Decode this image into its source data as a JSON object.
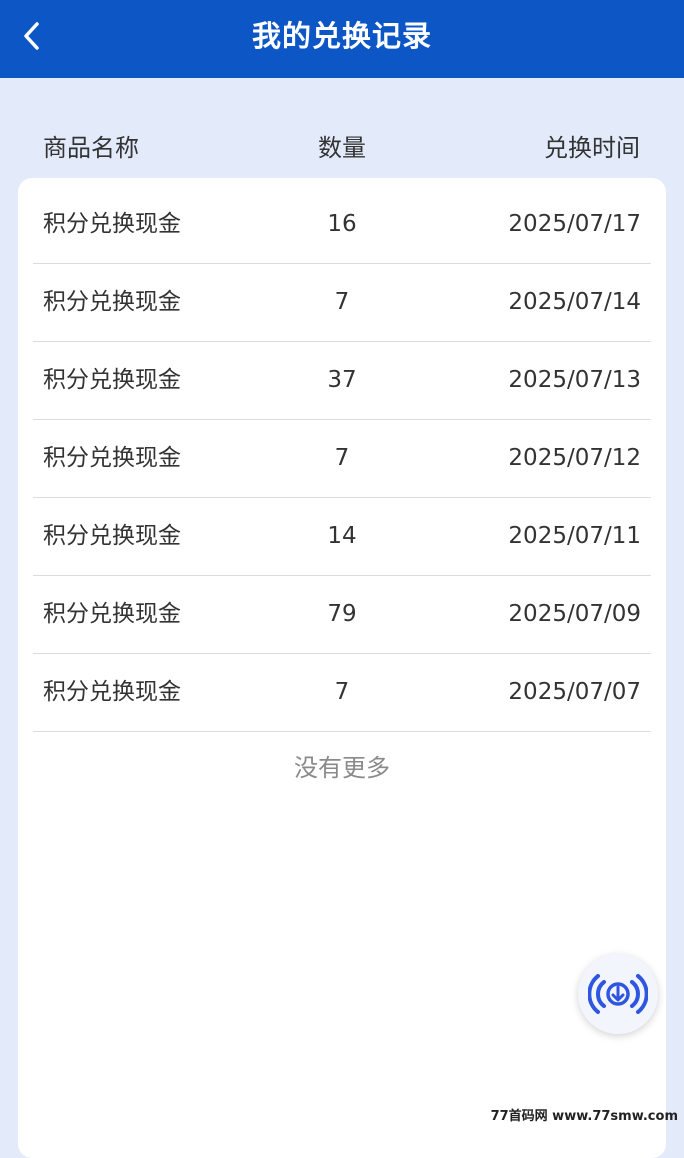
{
  "header": {
    "title": "我的兑换记录",
    "back_icon": "chevron-left-icon",
    "background": "#0d56c6"
  },
  "columns": {
    "name": "商品名称",
    "quantity": "数量",
    "time": "兑换时间"
  },
  "records": [
    {
      "name": "积分兑换现金",
      "quantity": "16",
      "time": "2025/07/17"
    },
    {
      "name": "积分兑换现金",
      "quantity": "7",
      "time": "2025/07/14"
    },
    {
      "name": "积分兑换现金",
      "quantity": "37",
      "time": "2025/07/13"
    },
    {
      "name": "积分兑换现金",
      "quantity": "7",
      "time": "2025/07/12"
    },
    {
      "name": "积分兑换现金",
      "quantity": "14",
      "time": "2025/07/11"
    },
    {
      "name": "积分兑换现金",
      "quantity": "79",
      "time": "2025/07/09"
    },
    {
      "name": "积分兑换现金",
      "quantity": "7",
      "time": "2025/07/07"
    }
  ],
  "footer": {
    "no_more": "没有更多"
  },
  "floating_button": {
    "icon": "download-broadcast-icon",
    "color": "#2f56e0"
  },
  "watermark": "77首码网 www.77smw.com"
}
